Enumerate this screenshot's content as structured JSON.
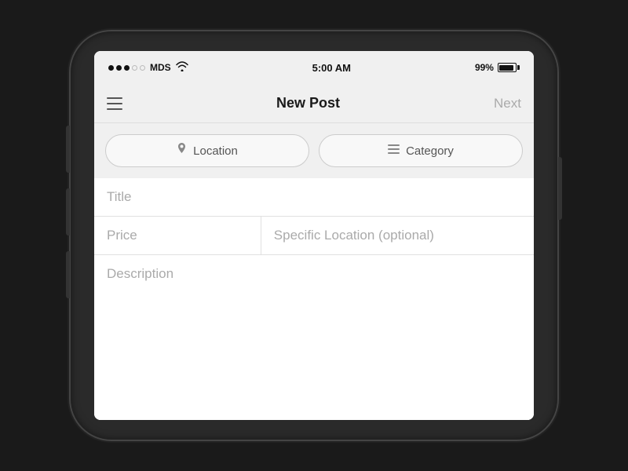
{
  "statusBar": {
    "carrier": "MDS",
    "time": "5:00 AM",
    "battery": "99%"
  },
  "navBar": {
    "menuIcon": "menu-icon",
    "title": "New Post",
    "nextLabel": "Next"
  },
  "buttons": [
    {
      "id": "location-btn",
      "icon": "📍",
      "label": "Location"
    },
    {
      "id": "category-btn",
      "icon": "≡",
      "label": "Category"
    }
  ],
  "formFields": {
    "titlePlaceholder": "Title",
    "pricePlaceholder": "Price",
    "specificLocationPlaceholder": "Specific Location (optional)",
    "descriptionPlaceholder": "Description"
  }
}
